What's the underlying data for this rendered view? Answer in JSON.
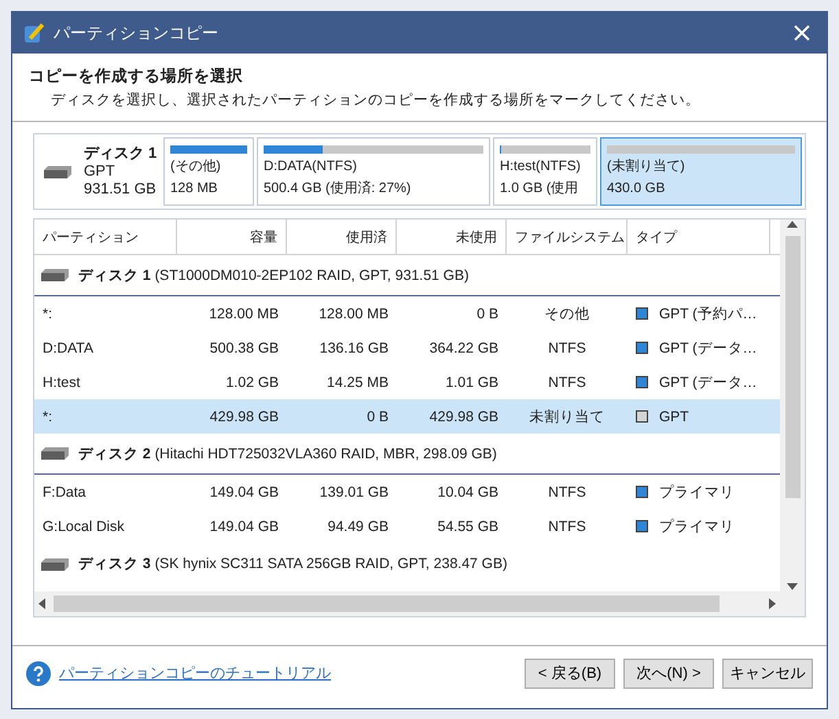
{
  "window": {
    "title": "パーティションコピー"
  },
  "header": {
    "title": "コピーを作成する場所を選択",
    "description": "ディスクを選択し、選択されたパーティションのコピーを作成する場所をマークしてください。"
  },
  "disk_map": {
    "disk": {
      "name": "ディスク 1",
      "scheme": "GPT",
      "size": "931.51 GB"
    },
    "partitions": [
      {
        "label": "(その他)",
        "size": "128 MB",
        "level": 1,
        "selected": false
      },
      {
        "label": "D:DATA(NTFS)",
        "size": "500.4 GB (使用済: 27%)",
        "level": 0.27,
        "selected": false
      },
      {
        "label": "H:test(NTFS)",
        "size": "1.0 GB (使用",
        "level": 0.02,
        "selected": false
      },
      {
        "label": "(未割り当て)",
        "size": "430.0 GB",
        "level": 0,
        "selected": true
      }
    ]
  },
  "table": {
    "columns": [
      "パーティション",
      "容量",
      "使用済",
      "未使用",
      "ファイルシステム",
      "タイプ"
    ],
    "rows": [
      {
        "kind": "disk",
        "name": "ディスク 1",
        "detail": "(ST1000DM010-2EP102 RAID, GPT, 931.51 GB)"
      },
      {
        "kind": "partition",
        "cells": [
          "*:",
          "128.00 MB",
          "128.00 MB",
          "0 B",
          "その他"
        ],
        "type": "GPT (予約パ…",
        "color": "#2f86d6",
        "selected": false
      },
      {
        "kind": "partition",
        "cells": [
          "D:DATA",
          "500.38 GB",
          "136.16 GB",
          "364.22 GB",
          "NTFS"
        ],
        "type": "GPT (データ…",
        "color": "#2f86d6",
        "selected": false
      },
      {
        "kind": "partition",
        "cells": [
          "H:test",
          "1.02 GB",
          "14.25 MB",
          "1.01 GB",
          "NTFS"
        ],
        "type": "GPT (データ…",
        "color": "#2f86d6",
        "selected": false
      },
      {
        "kind": "partition",
        "cells": [
          "*:",
          "429.98 GB",
          "0 B",
          "429.98 GB",
          "未割り当て"
        ],
        "type": "GPT",
        "color": "#d4d4d4",
        "selected": true
      },
      {
        "kind": "disk",
        "name": "ディスク 2",
        "detail": "(Hitachi HDT725032VLA360 RAID, MBR, 298.09 GB)"
      },
      {
        "kind": "partition",
        "cells": [
          "F:Data",
          "149.04 GB",
          "139.01 GB",
          "10.04 GB",
          "NTFS"
        ],
        "type": "プライマリ",
        "color": "#2f86d6",
        "selected": false
      },
      {
        "kind": "partition",
        "cells": [
          "G:Local Disk",
          "149.04 GB",
          "94.49 GB",
          "54.55 GB",
          "NTFS"
        ],
        "type": "プライマリ",
        "color": "#2f86d6",
        "selected": false
      },
      {
        "kind": "disk",
        "name": "ディスク 3",
        "detail": "(SK hynix SC311 SATA 256GB RAID, GPT, 238.47 GB)"
      }
    ]
  },
  "footer": {
    "help_link": "パーティションコピーのチュートリアル",
    "buttons": [
      "< 戻る(B)",
      "次へ(N) >",
      "キャンセル"
    ]
  }
}
